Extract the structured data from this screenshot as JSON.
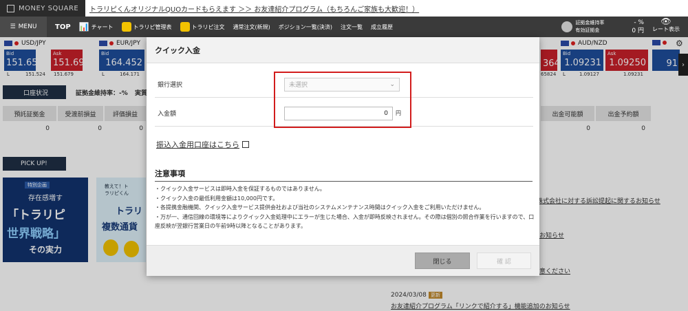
{
  "top": {
    "logo": "MONEY SQUARE",
    "banner": "トラリピくんオリジナルQUOカードもらえます ＞＞ お友達紹介プログラム（もちろんご家族も大歓迎！）"
  },
  "nav": {
    "menu": "MENU",
    "top": "TOP",
    "chart": "チャート",
    "manage": "トラリピ管理表",
    "trarepi_order": "トラリピ注文",
    "normal_order": "通常注文(新規)",
    "positions": "ポジション一覧(決済)",
    "orders": "注文一覧",
    "history": "成立履歴",
    "margin_rate_label": "証拠金維持率",
    "margin_label": "有効証拠金",
    "margin_rate_value": "- %",
    "margin_value": "0 円",
    "rate_display": "レート表示"
  },
  "ticker": [
    {
      "pair": "USD/JPY",
      "bid_label": "Bid",
      "bid": "151.654",
      "ask_label": "Ask",
      "ask": "151.698",
      "low_l": "L",
      "low_bid": "151.524",
      "low_ask": "151.679"
    },
    {
      "pair": "EUR/JPY",
      "bid_label": "Bid",
      "bid": "164.452",
      "low_l": "L",
      "low_bid": "164.171"
    },
    {
      "pair": "AUD/NZD",
      "bid_label": "Bid",
      "bid": "1.09231",
      "ask_label": "Ask",
      "ask": "1.09250",
      "low_l": "L",
      "low_bid": "1.09127",
      "low_ask": "1.09231"
    }
  ],
  "ticker_partial": {
    "left_partial": "364",
    "left_low": "65824",
    "right_bid": "91"
  },
  "account": {
    "tab": "口座状況",
    "margin_rate": "証拠金維持率：-%",
    "realized": "実質",
    "headers": [
      "預託証拠金",
      "受渡前損益",
      "評価損益",
      "出金可能額",
      "出金予約額"
    ],
    "values": [
      "0",
      "0",
      "0",
      "0",
      "0"
    ]
  },
  "pickup": {
    "tab": "PICK UP!",
    "img_tag": "特別企画",
    "img_line1": "存在感増す",
    "img_line2": "「トラリピ",
    "img_line3": "世界戦略」",
    "img_line4": "その実力",
    "img2_tag": "教えて！トラリピくん",
    "img2_line1": "トラリ",
    "img2_line2": "複数通貨"
  },
  "news": [
    {
      "text": "株式会社に対する訴訟提起に関するお知らせ"
    },
    {
      "text": "お知らせ"
    },
    {
      "text": "意ください"
    },
    {
      "date": "2024/03/08",
      "badge": "更新",
      "text": "お友達紹介プログラム「リンクで紹介する」機能追加のお知らせ"
    }
  ],
  "modal": {
    "title": "クイック入金",
    "bank_label": "銀行選択",
    "bank_placeholder": "未選択",
    "amount_label": "入金額",
    "amount_value": "0",
    "amount_unit": "円",
    "link": "振込入金用口座はこちら",
    "notes_title": "注意事項",
    "notes": [
      "・クイック入金サービスは即時入金を保証するものではありません。",
      "・クイック入金の最低利用金額は10,000円です。",
      "・各提携金融機関、クイック入金サービス提供会社および当社のシステムメンテナンス時間はクイック入金をご利用いただけません。",
      "・万が一、通信回線の環境等によりクイック入金処理中にエラーが生じた場合、入金が即時反映されません。その際は個別の照合作業を行いますので、口座反映が翌銀行営業日の午前9時以降となることがあります。"
    ],
    "close": "閉じる",
    "confirm": "確 認"
  }
}
